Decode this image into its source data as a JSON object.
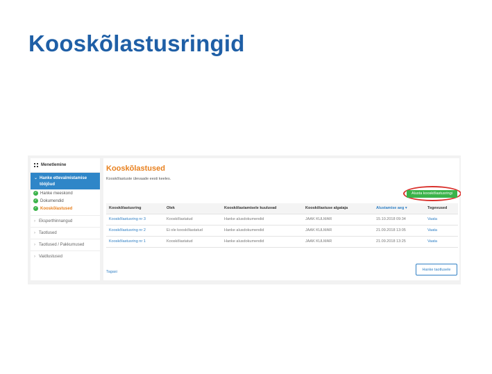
{
  "slide": {
    "title": "Kooskõlastusringid"
  },
  "sidebar": {
    "header": "Menetlemine",
    "active_section": [
      "Hanke ettevalmistamise",
      "tööjõud"
    ],
    "sub_items": [
      {
        "label": "Hanke meeskond",
        "status": "done"
      },
      {
        "label": "Dokumendid",
        "status": "done"
      },
      {
        "label": "Kooskõlastused",
        "status": "current"
      }
    ],
    "items": [
      {
        "label": "Eksperthinnangud"
      },
      {
        "label": "Taotlused"
      },
      {
        "label": "Taotlused / Pakkumused"
      },
      {
        "label": "Vaidlustused"
      }
    ]
  },
  "main": {
    "title": "Kooskõlastused",
    "description": "Kooskõlastuste ülevaade eesti keeles.",
    "start_button": "Alusta kooskõlastusringi",
    "columns": [
      "Kooskõlastusring",
      "Olek",
      "Kooskõlastamisele kuuluvad",
      "Kooskõlastuse algataja",
      "Alustamise aeg ▾",
      "Tegevused"
    ],
    "rows": [
      [
        "Kooskõlastusring nr 3",
        "Kooskõlastatud",
        "Hanke alusdokumendid",
        "JAAK KULMAR",
        "15.10.2018 09:34",
        "Vaata"
      ],
      [
        "Kooskõlastusring nr 2",
        "Ei ole kooskõlastatud",
        "Hanke alusdokumendid",
        "JAAK KULMAR",
        "21.09.2018 13:05",
        "Vaata"
      ],
      [
        "Kooskõlastusring nr 1",
        "Kooskõlastatud",
        "Hanke alusdokumendid",
        "JAAK KULMAR",
        "21.09.2018 13:25",
        "Vaata"
      ]
    ],
    "back_link": "Tagasi",
    "submit_button": "Hanke taotlusele"
  },
  "colors": {
    "title_blue": "#1f5fa6",
    "accent_orange": "#e8801e",
    "primary_blue": "#2f86c8",
    "success_green": "#3bb34a",
    "highlight_red": "#d9302b"
  }
}
